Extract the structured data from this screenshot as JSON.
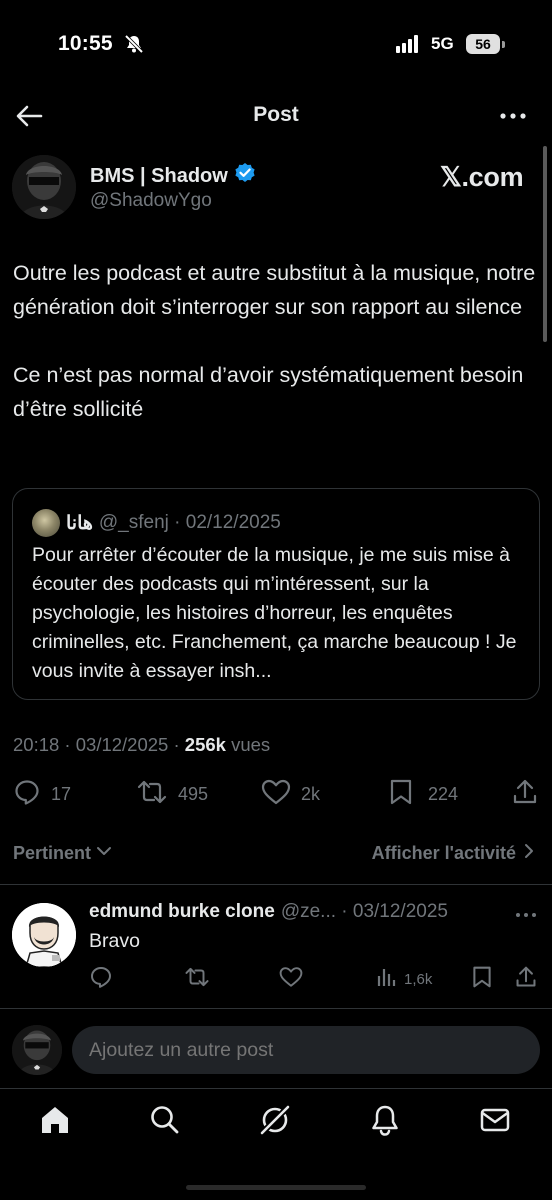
{
  "status_bar": {
    "time": "10:55",
    "network": "5G",
    "battery": "56"
  },
  "header": {
    "title": "Post"
  },
  "post": {
    "author_name": "BMS | Shadow",
    "author_handle": "@ShadowYgo",
    "watermark": "𝕏.com",
    "text_p1": "Outre les podcast et autre substitut à la musique, notre génération doit s’interroger sur son rapport au silence",
    "text_p2": "Ce n’est pas normal d’avoir systématiquement besoin d’être sollicité",
    "timestamp": "20:18 · 03/12/2025 · ",
    "views_count": "256k",
    "views_label": " vues",
    "stats": {
      "replies": "17",
      "reposts": "495",
      "likes": "2k",
      "bookmarks": "224"
    }
  },
  "quote": {
    "name": "هانا",
    "handle_date": "@_sfenj · 02/12/2025",
    "text": "Pour arrêter d’écouter de la musique, je me suis mise à écouter des podcasts qui m’intéressent, sur la psychologie, les histoires d’horreur, les enquêtes criminelles, etc. Franchement, ça marche beaucoup ! Je vous invite à essayer insh..."
  },
  "filter": {
    "left_label": "Pertinent",
    "right_label": "Afficher l'activité"
  },
  "reply": {
    "name": "edmund burke clone",
    "meta": "@ze... · 03/12/2025",
    "text": "Bravo",
    "views": "1,6k"
  },
  "compose": {
    "placeholder": "Ajoutez un autre post"
  },
  "colors": {
    "background": "#000000",
    "text": "#e7e9ea",
    "muted": "#71767b",
    "verified": "#1d9bf0",
    "border": "#2f3336"
  },
  "icons": [
    "back-arrow-icon",
    "more-icon",
    "verified-icon",
    "reply-icon",
    "repost-icon",
    "like-icon",
    "bookmark-icon",
    "share-icon",
    "chevron-down-icon",
    "chevron-right-icon",
    "views-icon",
    "home-icon",
    "search-icon",
    "grok-icon",
    "notifications-icon",
    "messages-icon"
  ]
}
